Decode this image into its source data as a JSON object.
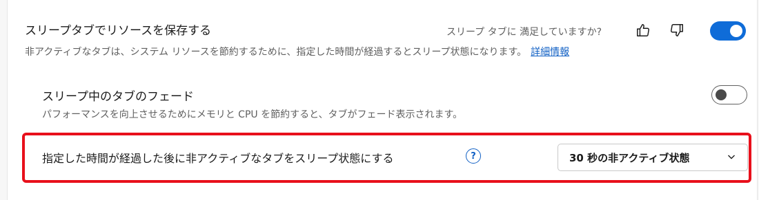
{
  "sleeping_tabs": {
    "title": "スリープタブでリソースを保存する",
    "feedback_question": "スリープ タブに 満足していますか?",
    "description": "非アクティブなタブは、システム リソースを節約するために、指定した時間が経過するとスリープ状態になります。",
    "learn_more": "詳細情報",
    "toggle_state": "on",
    "icons": {
      "thumbs_up": "thumbs-up-icon",
      "thumbs_down": "thumbs-down-icon"
    }
  },
  "fade_tabs": {
    "title": "スリープ中のタブのフェード",
    "description": "パフォーマンスを向上させるためにメモリと CPU を節約すると、タブがフェード表示されます。",
    "toggle_state": "off"
  },
  "sleep_after": {
    "label": "指定した時間が経過した後に非アクティブなタブをスリープ状態にする",
    "help_glyph": "?",
    "selected_option": "30 秒の非アクティブ状態"
  },
  "colors": {
    "accent": "#0f6cd8",
    "link": "#0f5fc4",
    "highlight_border": "#e8101b",
    "secondary_text": "#5f5f5f"
  }
}
